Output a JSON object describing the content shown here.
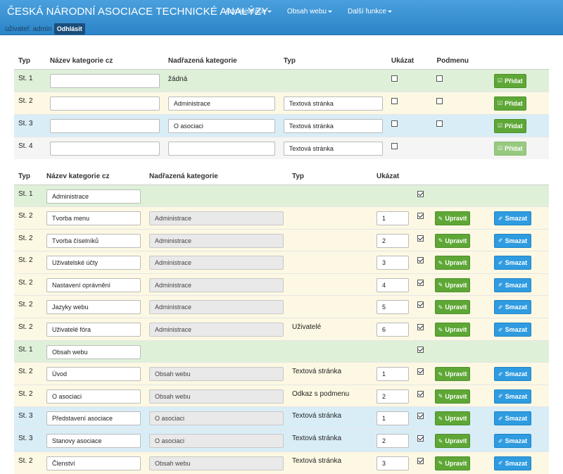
{
  "header": {
    "brand": "ČESKÁ NÁRODNÍ ASOCIACE TECHNICKÉ ANALÝZY",
    "nav": [
      "Administrace",
      "Obsah webu",
      "Další funkce"
    ],
    "user_label": "uživatel: admin",
    "logout_label": "Odhlásit"
  },
  "add_table": {
    "columns": [
      "Typ",
      "Název kategorie cz",
      "Nadřazená kategorie",
      "Typ",
      "Ukázat",
      "Podmenu"
    ],
    "add_label": "Přidat",
    "rows": [
      {
        "typ": "St. 1",
        "name": "",
        "parent": "žádná",
        "page_type": ""
      },
      {
        "typ": "St. 2",
        "name": "",
        "parent": "Administrace",
        "page_type": "Textová stránka"
      },
      {
        "typ": "St. 3",
        "name": "",
        "parent": "O asociaci",
        "page_type": "Textová stránka"
      },
      {
        "typ": "St. 4",
        "name": "",
        "parent": "",
        "page_type": "Textová stránka"
      }
    ]
  },
  "list_table": {
    "columns": [
      "Typ",
      "Název kategorie cz",
      "Nadřazená kategorie",
      "Typ",
      "Ukázat"
    ],
    "edit_label": "Upravit",
    "delete_label": "Smazat",
    "rows": [
      {
        "typ": "St. 1",
        "name": "Administrace",
        "parent": "",
        "page_type": "",
        "order": "",
        "show": true
      },
      {
        "typ": "St. 2",
        "name": "Tvorba menu",
        "parent": "Administrace",
        "page_type": "",
        "order": "1",
        "show": true
      },
      {
        "typ": "St. 2",
        "name": "Tvorba číselníků",
        "parent": "Administrace",
        "page_type": "",
        "order": "2",
        "show": true
      },
      {
        "typ": "St. 2",
        "name": "Uživatelské účty",
        "parent": "Administrace",
        "page_type": "",
        "order": "3",
        "show": true
      },
      {
        "typ": "St. 2",
        "name": "Nastavení oprávnění",
        "parent": "Administrace",
        "page_type": "",
        "order": "4",
        "show": true
      },
      {
        "typ": "St. 2",
        "name": "Jazyky webu",
        "parent": "Administrace",
        "page_type": "",
        "order": "5",
        "show": true
      },
      {
        "typ": "St. 2",
        "name": "Uživatelé fóra",
        "parent": "Administrace",
        "page_type": "Uživatelé",
        "order": "6",
        "show": true
      },
      {
        "typ": "St. 1",
        "name": "Obsah webu",
        "parent": "",
        "page_type": "",
        "order": "",
        "show": true
      },
      {
        "typ": "St. 2",
        "name": "Úvod",
        "parent": "Obsah webu",
        "page_type": "Textová stránka",
        "order": "1",
        "show": true
      },
      {
        "typ": "St. 2",
        "name": "O asociaci",
        "parent": "Obsah webu",
        "page_type": "Odkaz s podmenu",
        "order": "2",
        "show": true
      },
      {
        "typ": "St. 3",
        "name": "Představení asociace",
        "parent": "O asociaci",
        "page_type": "Textová stránka",
        "order": "1",
        "show": true
      },
      {
        "typ": "St. 3",
        "name": "Stanovy asociace",
        "parent": "O asociaci",
        "page_type": "Textová stránka",
        "order": "2",
        "show": true
      },
      {
        "typ": "St. 2",
        "name": "Členství",
        "parent": "Obsah webu",
        "page_type": "Textová stránka",
        "order": "3",
        "show": true
      }
    ]
  }
}
